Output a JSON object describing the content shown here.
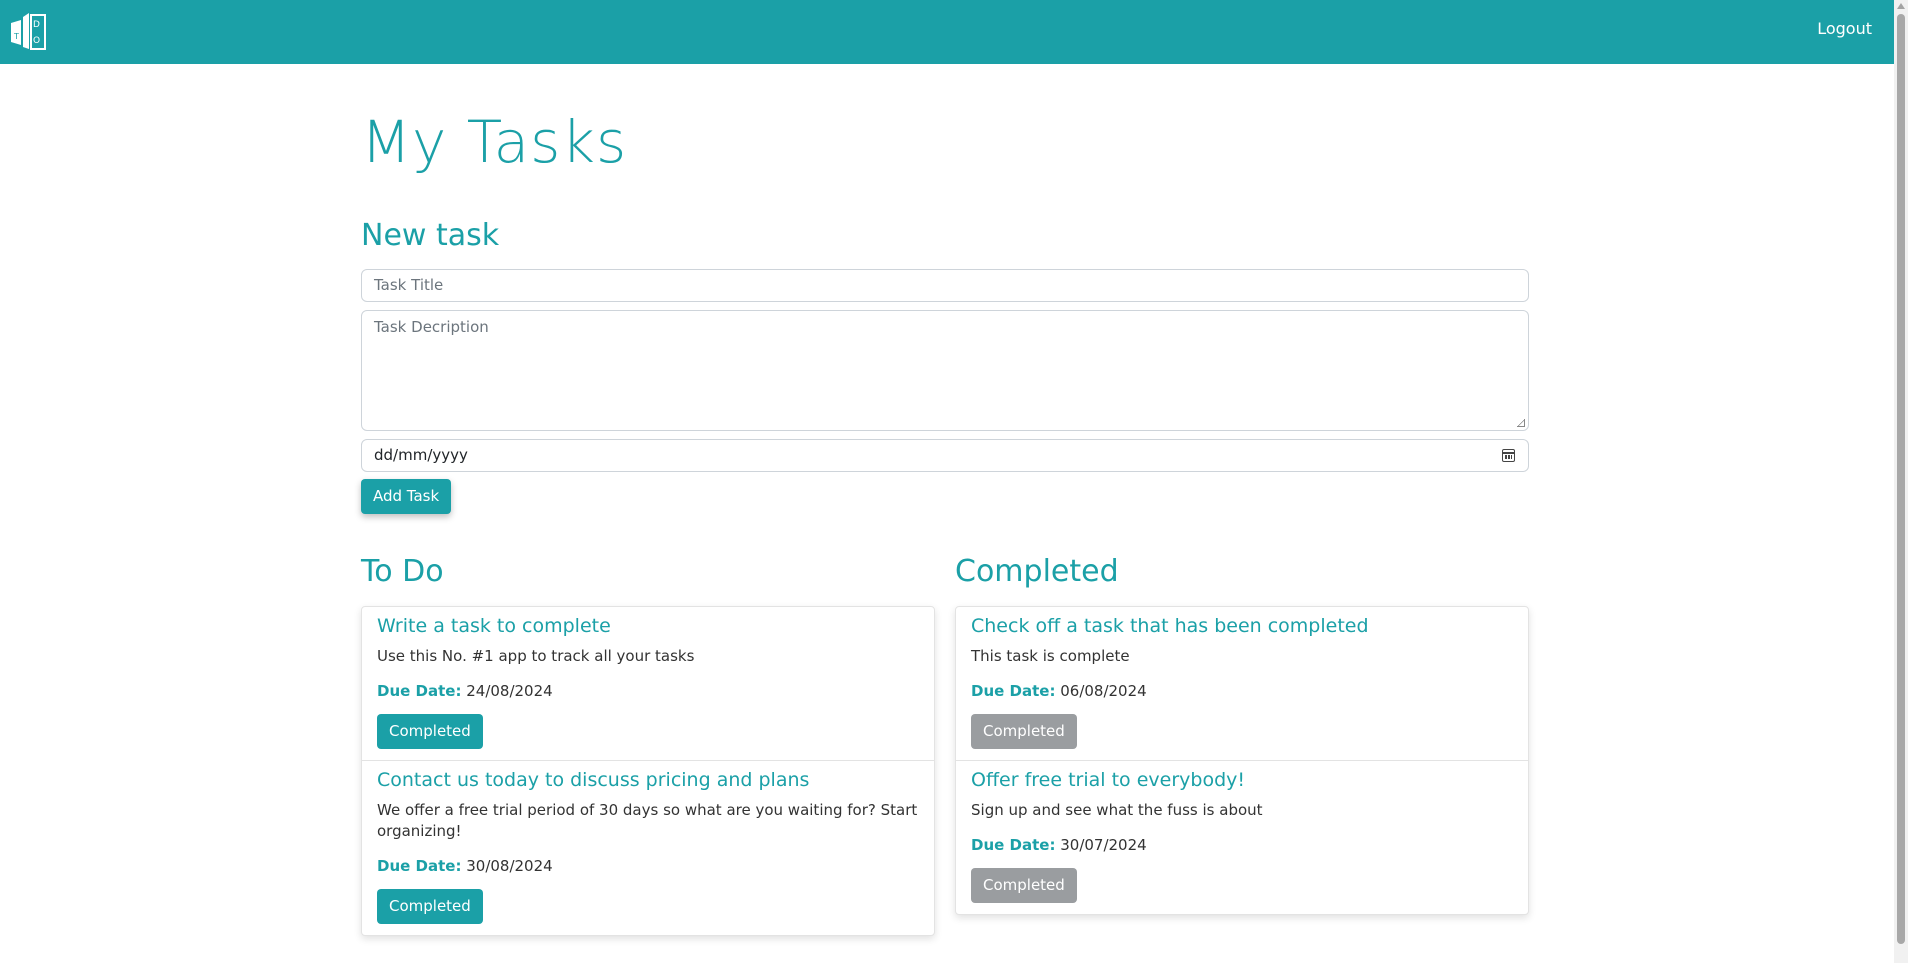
{
  "navbar": {
    "logout_label": "Logout",
    "brand_color": "#1ba0a7",
    "logo_icon": "todo-building-logo-icon"
  },
  "page": {
    "title": "My Tasks"
  },
  "new_task": {
    "heading": "New task",
    "title_placeholder": "Task Title",
    "description_placeholder": "Task Decription",
    "date_placeholder": "dd/mm/yyyy",
    "add_button": "Add Task"
  },
  "todo": {
    "heading": "To Do",
    "tasks": [
      {
        "title": "Write a task to complete",
        "description": "Use this No. #1 app to track all your tasks",
        "due_label": "Due Date:",
        "due_date": "24/08/2024",
        "button": "Completed"
      },
      {
        "title": "Contact us today to discuss pricing and plans",
        "description": "We offer a free trial period of 30 days so what are you waiting for? Start organizing!",
        "due_label": "Due Date:",
        "due_date": "30/08/2024",
        "button": "Completed"
      }
    ]
  },
  "completed": {
    "heading": "Completed",
    "tasks": [
      {
        "title": "Check off a task that has been completed",
        "description": "This task is complete",
        "due_label": "Due Date:",
        "due_date": "06/08/2024",
        "button": "Completed"
      },
      {
        "title": "Offer free trial to everybody!",
        "description": "Sign up and see what the fuss is about",
        "due_label": "Due Date:",
        "due_date": "30/07/2024",
        "button": "Completed"
      }
    ]
  }
}
